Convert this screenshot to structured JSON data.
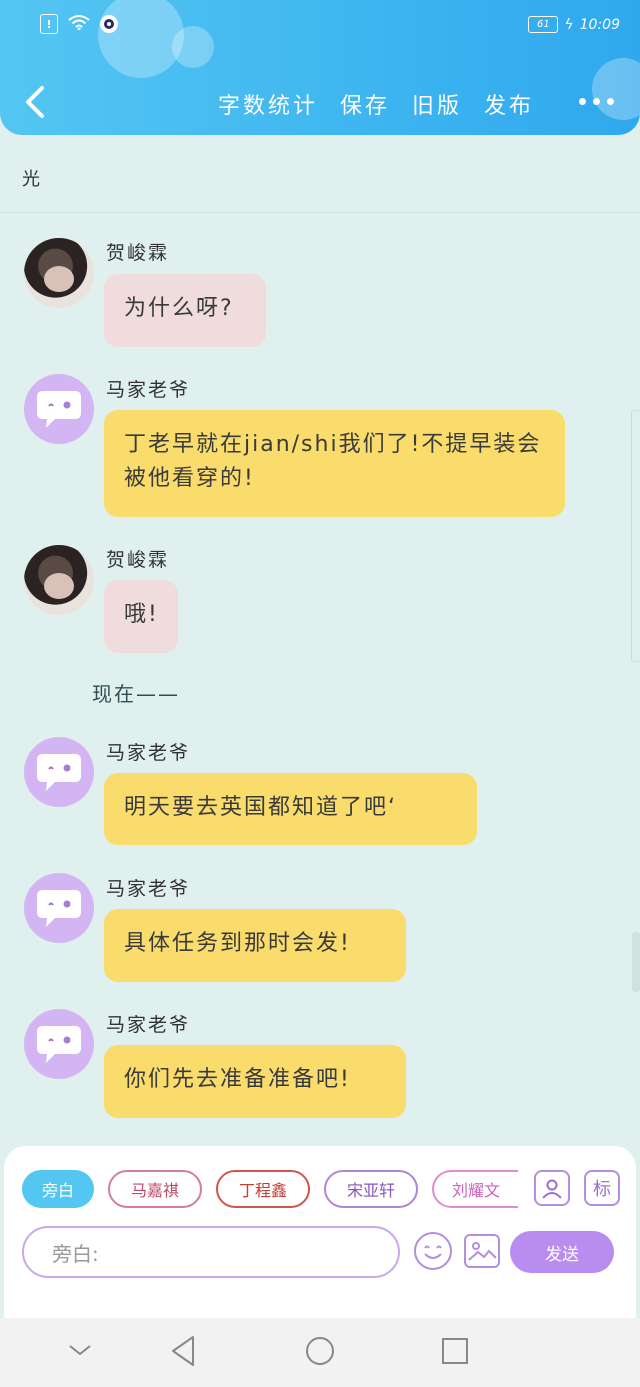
{
  "status_bar": {
    "battery": "61",
    "time": "10:09"
  },
  "header": {
    "menu": [
      "字数统计",
      "保存",
      "旧版",
      "发布"
    ]
  },
  "doc_title": "光",
  "messages": [
    {
      "name": "贺峻霖",
      "text": "为什么呀?",
      "avatar": "photo",
      "style": "pink"
    },
    {
      "name": "马家老爷",
      "text": "丁老早就在jian/shi我们了!不提早装会被他看穿的!",
      "avatar": "bot",
      "style": "yellow"
    },
    {
      "name": "贺峻霖",
      "text": "哦!",
      "avatar": "photo",
      "style": "pink"
    },
    {
      "name": "马家老爷",
      "text": "明天要去英国都知道了吧‘",
      "avatar": "bot",
      "style": "yellow"
    },
    {
      "name": "马家老爷",
      "text": "具体任务到那时会发!",
      "avatar": "bot",
      "style": "yellow"
    },
    {
      "name": "马家老爷",
      "text": "你们先去准备准备吧!",
      "avatar": "bot",
      "style": "yellow"
    }
  ],
  "narration": "现在——",
  "composer": {
    "chips": [
      "旁白",
      "马嘉祺",
      "丁程鑫",
      "宋亚轩",
      "刘耀文"
    ],
    "tag_label": "标",
    "input_placeholder": "旁白:",
    "send_label": "发送"
  }
}
